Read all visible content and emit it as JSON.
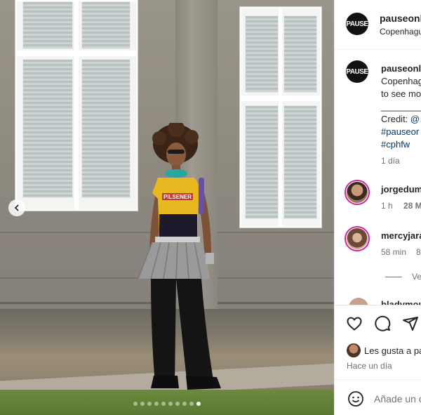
{
  "post": {
    "carousel": {
      "prev_icon": "chevron-left-icon",
      "slide_count": 10,
      "active_index": 9
    },
    "print_text": {
      "shirt": "PILSENER"
    }
  },
  "header": {
    "avatar_text": "PAUSE",
    "username": "pauseonli",
    "location": "Copenhagu"
  },
  "caption": {
    "avatar_text": "PAUSE",
    "username": "pauseonl",
    "line1": "Copenhag",
    "line2": "to see mo",
    "separator": "___________",
    "credit_label": "Credit: ",
    "credit_handle": "@",
    "hashtag1": "#pauseor",
    "hashtag2": "#cphfw",
    "time": "1 día"
  },
  "comments": [
    {
      "username": "jorgedum",
      "time": "1 h",
      "extra": "28 M"
    },
    {
      "username": "mercyjara",
      "time": "58 min",
      "extra": "8"
    }
  ],
  "view_replies": "Ve",
  "partial_comment_user": "bladymou",
  "actions": {
    "like_icon": "heart-icon",
    "comment_icon": "comment-icon",
    "share_icon": "share-icon"
  },
  "likes": {
    "text": "Les gusta a pa",
    "time": "Hace un día"
  },
  "add_comment": {
    "emoji_icon": "emoji-icon",
    "placeholder": "Añade un co"
  },
  "colors": {
    "link": "#00376b",
    "ring": "#d6249f",
    "muted": "#737373"
  }
}
